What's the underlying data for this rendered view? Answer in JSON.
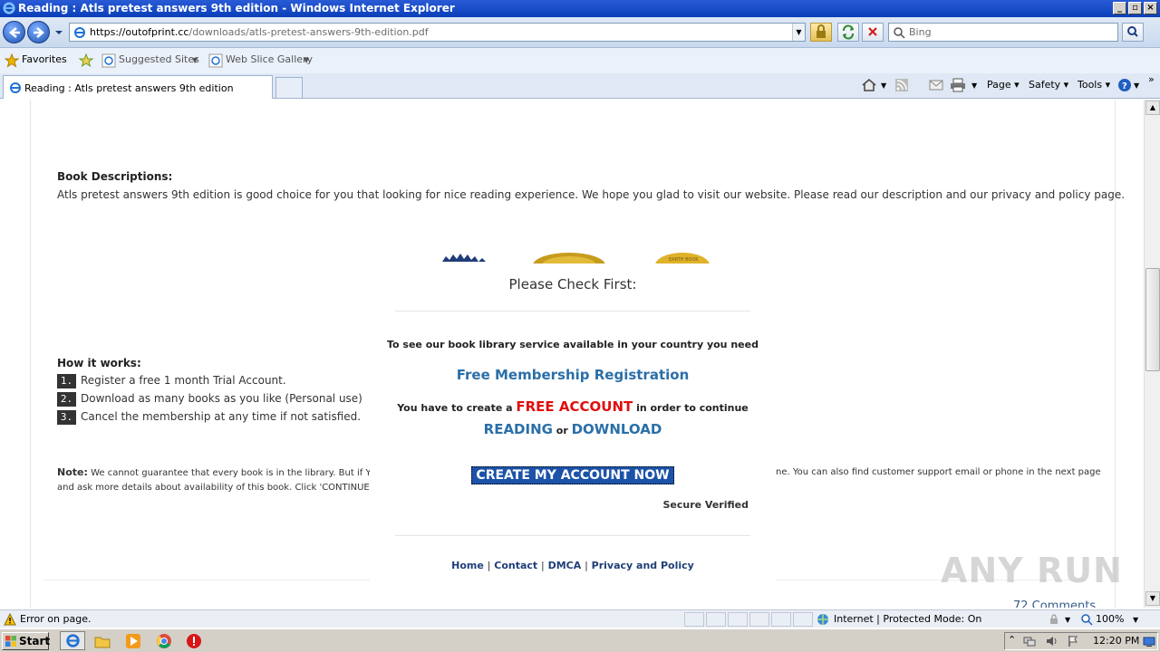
{
  "window": {
    "title": "Reading : Atls pretest answers 9th edition - Windows Internet Explorer"
  },
  "address_bar": {
    "url_host": "https://outofprint.cc",
    "url_path": "/downloads/atls-pretest-answers-9th-edition.pdf"
  },
  "search": {
    "placeholder": "Bing"
  },
  "favorites_bar": {
    "favorites": "Favorites",
    "suggested_sites": "Suggested Sites",
    "web_slice_gallery": "Web Slice Gallery"
  },
  "tab": {
    "label": "Reading : Atls pretest answers 9th edition"
  },
  "command_bar": {
    "page": "Page",
    "safety": "Safety",
    "tools": "Tools"
  },
  "page": {
    "book_desc_heading": "Book Descriptions:",
    "book_desc_text": "Atls pretest answers 9th edition is good choice for you that looking for nice reading experience. We hope you glad to visit our website. Please read our description and our privacy and policy page.",
    "how_heading": "How it works:",
    "steps": [
      {
        "num": "1.",
        "text": "Register a free 1 month Trial Account."
      },
      {
        "num": "2.",
        "text": "Download as many books as you like (Personal use)"
      },
      {
        "num": "3.",
        "text": "Cancel the membership at any time if not satisfied."
      }
    ],
    "note_label": "Note:",
    "note_text_1": " We cannot guarantee that every book is in the library. But if You",
    "note_text_2": "and ask more details about availability of this book. Click 'CONTINUE' butt",
    "note_text_right": "ne. You can also find customer support email or phone in the next page",
    "comments": "72 Comments"
  },
  "modal": {
    "title": "Please Check First:",
    "line1": "To see our book library service available in your country you need",
    "registration": "Free Membership Registration",
    "line2_pre": "You have to create a ",
    "line2_emph": "FREE ACCOUNT",
    "line2_post": " in order to continue",
    "reading": "READING",
    "or": " or ",
    "download": "DOWNLOAD",
    "cta": "CREATE MY ACCOUNT NOW",
    "secure": "Secure Verified",
    "links": [
      "Home",
      "Contact",
      "DMCA",
      "Privacy and Policy"
    ],
    "seal_text": "EARTH BOOK"
  },
  "status_bar": {
    "message": "Error on page.",
    "zone": "Internet | Protected Mode: On",
    "zoom": "100%"
  },
  "taskbar": {
    "start": "Start",
    "clock": "12:20 PM"
  },
  "watermark": "ANY RUN"
}
